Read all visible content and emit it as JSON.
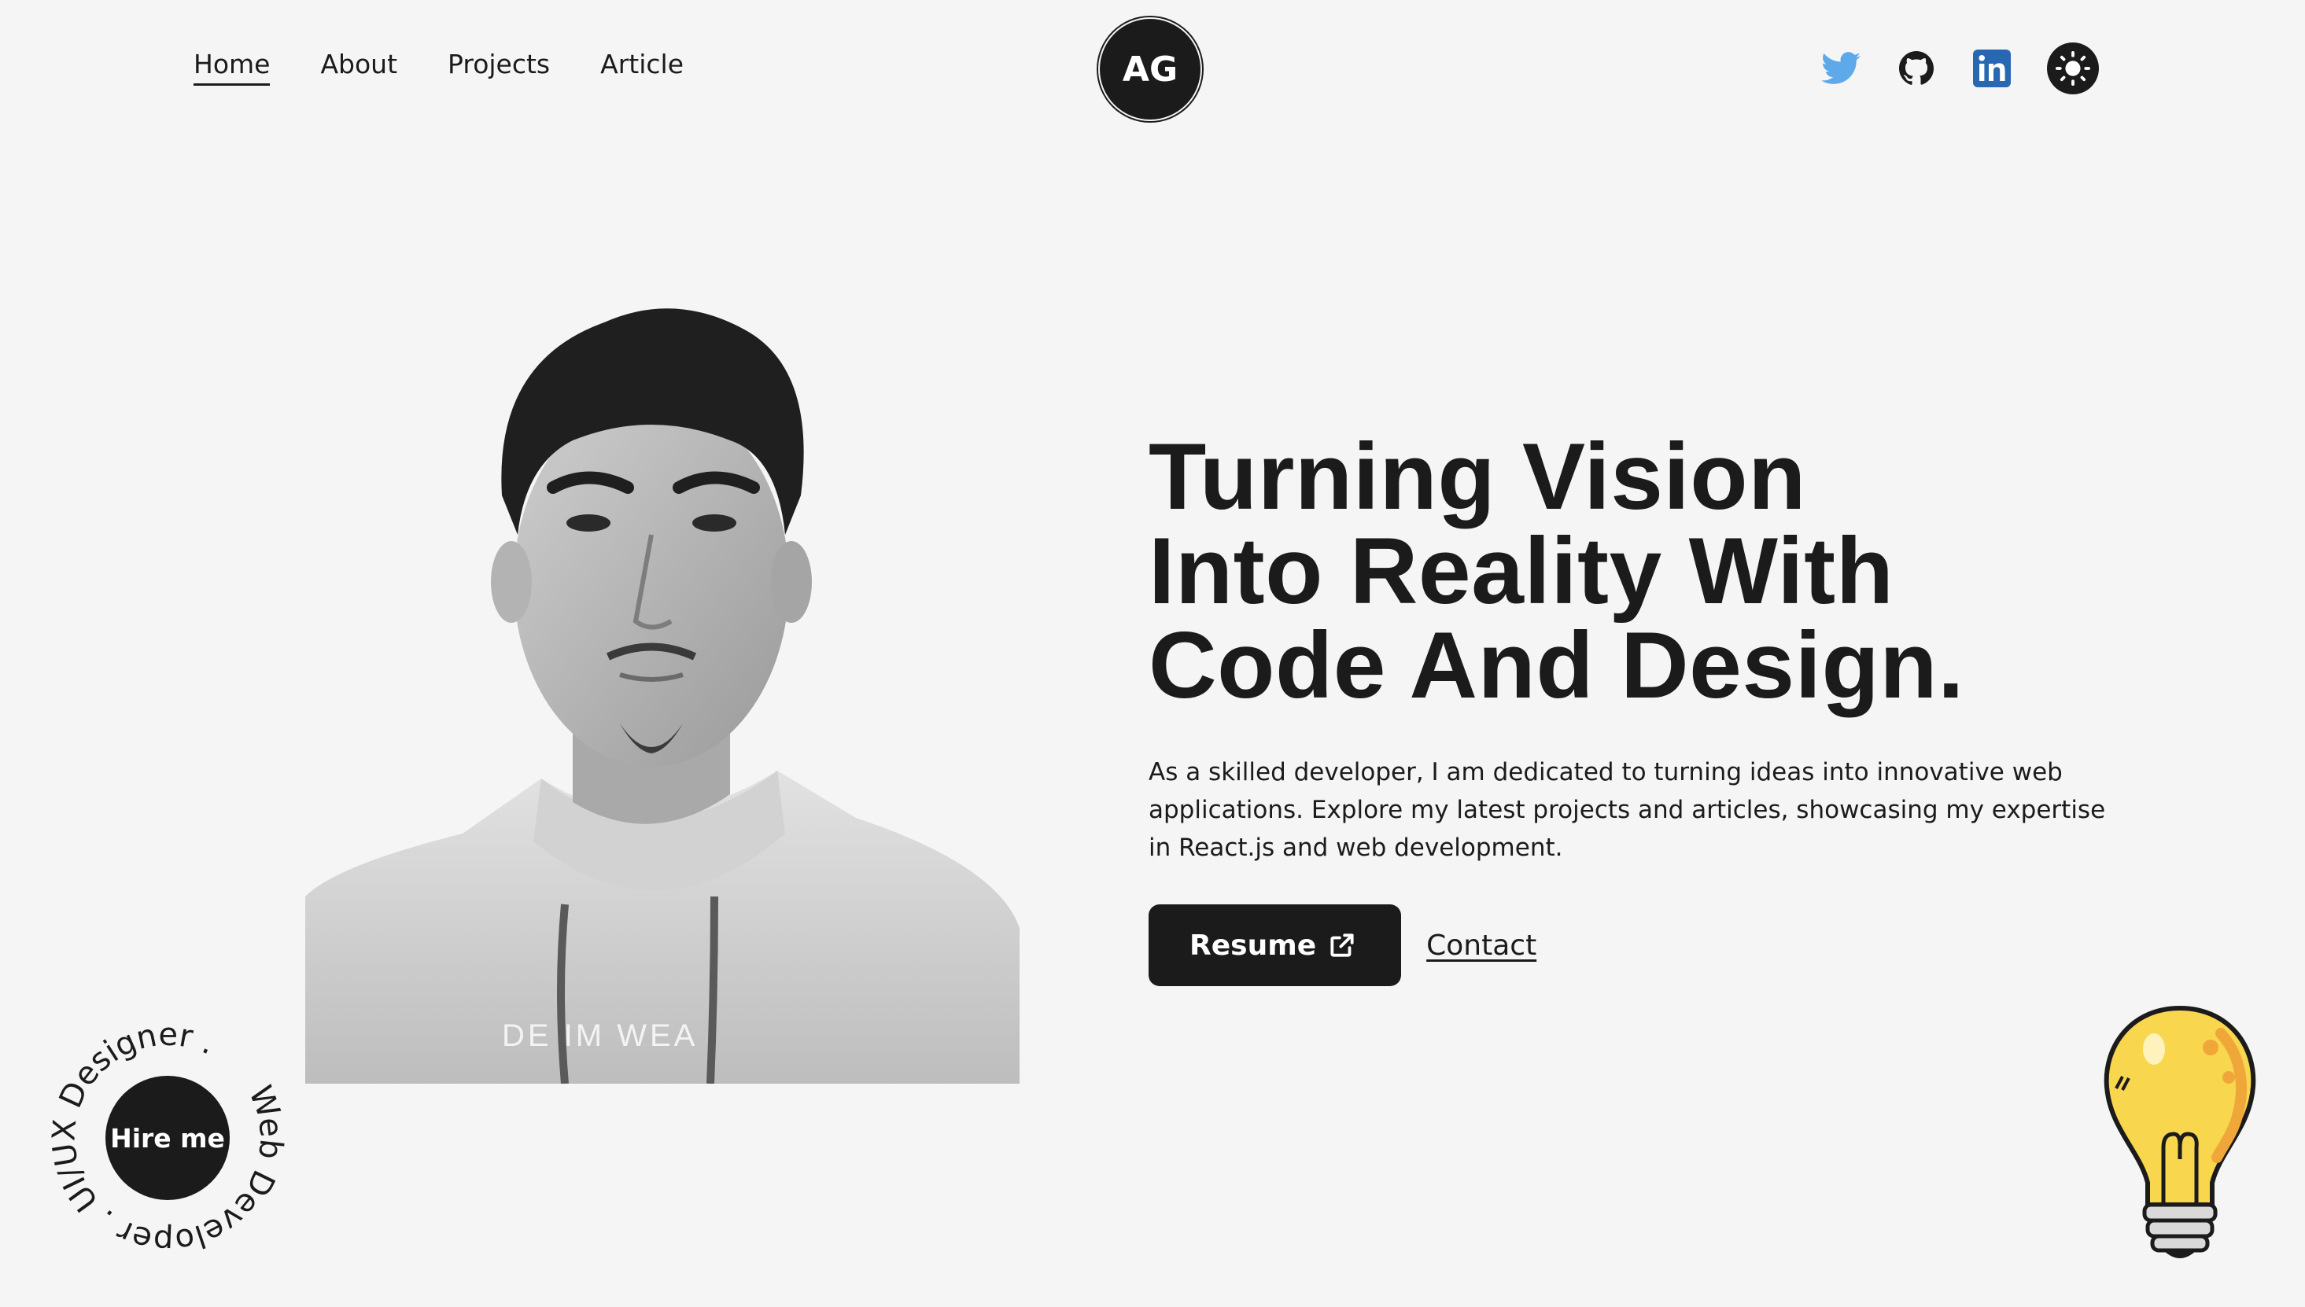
{
  "nav": {
    "links": [
      {
        "label": "Home",
        "active": true
      },
      {
        "label": "About",
        "active": false
      },
      {
        "label": "Projects",
        "active": false
      },
      {
        "label": "Article",
        "active": false
      }
    ],
    "logo": "AG",
    "socials": [
      "twitter-icon",
      "github-icon",
      "linkedin-icon",
      "theme-toggle-sun-icon"
    ]
  },
  "hero": {
    "headline_lines": [
      "Turning Vision",
      "Into Reality With",
      "Code And Design."
    ],
    "intro": "As a skilled developer, I am dedicated to turning ideas into innovative web applications. Explore my latest projects and articles, showcasing my expertise in React.js and web development.",
    "resume_label": "Resume",
    "contact_label": "Contact",
    "shirt_text": "DE  IM WEA"
  },
  "hire": {
    "label": "Hire me",
    "ring_text": "Web Developer . UI/UX Designer . "
  },
  "colors": {
    "background": "#f5f5f5",
    "text": "#1b1b1b",
    "twitter": "#5da9e9",
    "linkedin": "#2867b2",
    "bulb": "#f8d64e"
  }
}
